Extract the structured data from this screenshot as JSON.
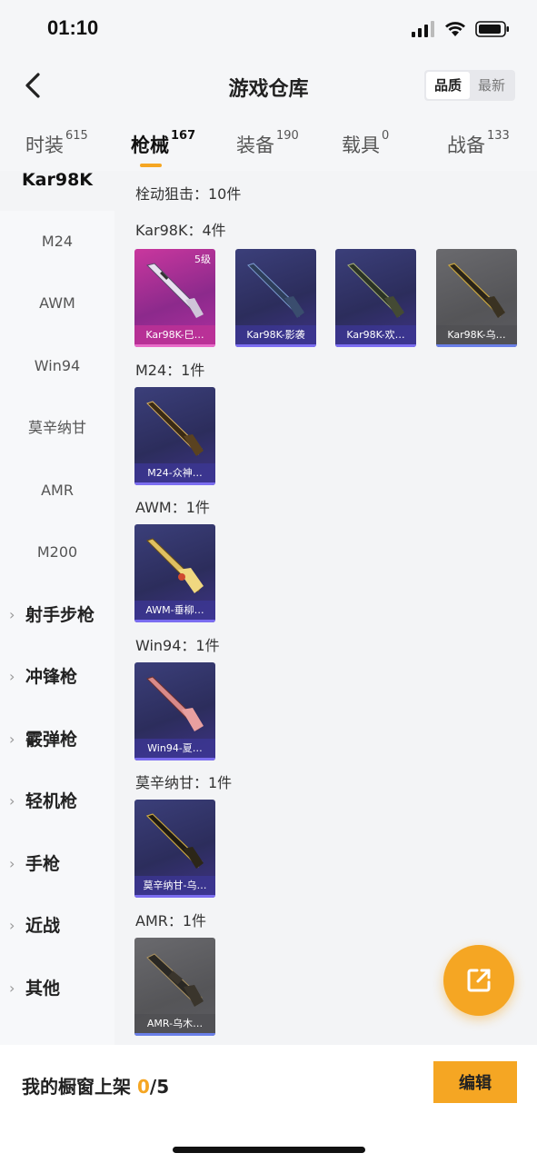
{
  "status_bar": {
    "time": "01:10"
  },
  "header": {
    "title": "游戏仓库",
    "sort_options": [
      "品质",
      "最新"
    ],
    "active_sort": "品质"
  },
  "tabs": [
    {
      "label": "时装",
      "count": "615"
    },
    {
      "label": "枪械",
      "count": "167"
    },
    {
      "label": "装备",
      "count": "190"
    },
    {
      "label": "载具",
      "count": "0"
    },
    {
      "label": "战备",
      "count": "133"
    }
  ],
  "active_tab": "枪械",
  "sidebar": {
    "selected": "Kar98K",
    "items": [
      "M24",
      "AWM",
      "Win94",
      "莫辛纳甘",
      "AMR",
      "M200"
    ],
    "groups": [
      "射手步枪",
      "冲锋枪",
      "霰弹枪",
      "轻机枪",
      "手枪",
      "近战",
      "其他"
    ]
  },
  "content": {
    "category_summary": "栓动狙击：10件",
    "sections": [
      {
        "label": "Kar98K：4件",
        "cards": [
          {
            "name": "Kar98K-巳…",
            "level": "5级",
            "rarity": "pink"
          },
          {
            "name": "Kar98K-影袭",
            "level": "",
            "rarity": "purple"
          },
          {
            "name": "Kar98K-欢…",
            "level": "",
            "rarity": "purple"
          },
          {
            "name": "Kar98K-乌…",
            "level": "",
            "rarity": "gray"
          }
        ]
      },
      {
        "label": "M24：1件",
        "cards": [
          {
            "name": "M24-众神…",
            "level": "",
            "rarity": "purple"
          }
        ]
      },
      {
        "label": "AWM：1件",
        "cards": [
          {
            "name": "AWM-垂柳…",
            "level": "",
            "rarity": "purple"
          }
        ]
      },
      {
        "label": "Win94：1件",
        "cards": [
          {
            "name": "Win94-夏…",
            "level": "",
            "rarity": "purple"
          }
        ]
      },
      {
        "label": "莫辛纳甘：1件",
        "cards": [
          {
            "name": "莫辛纳甘-乌…",
            "level": "",
            "rarity": "purple"
          }
        ]
      },
      {
        "label": "AMR：1件",
        "cards": [
          {
            "name": "AMR-乌木…",
            "level": "",
            "rarity": "gray"
          }
        ]
      }
    ]
  },
  "bottom_bar": {
    "shelf_label": "我的橱窗上架",
    "shelf_count": "0",
    "shelf_total": "/5",
    "edit_label": "编辑"
  },
  "colors": {
    "accent": "#f5a623",
    "purple_card": "#3b3f7a",
    "pink_card": "#c9379e",
    "gray_card": "#6a6a6e"
  }
}
